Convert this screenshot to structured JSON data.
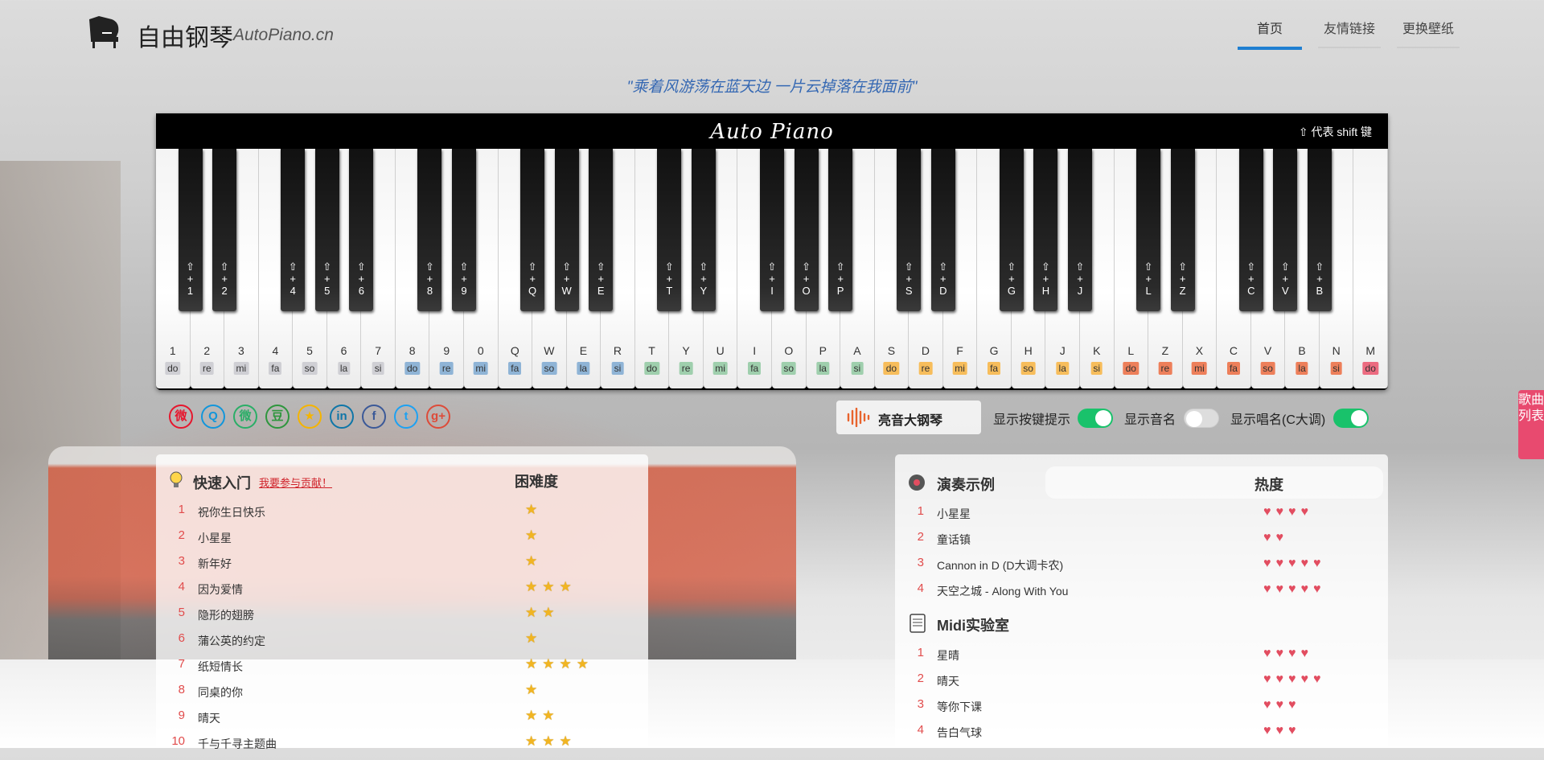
{
  "site": {
    "title": "自由钢琴",
    "subtitle": "AutoPiano.cn"
  },
  "nav": [
    {
      "label": "首页",
      "active": true
    },
    {
      "label": "友情链接",
      "active": false
    },
    {
      "label": "更换壁纸",
      "active": false
    }
  ],
  "quote": "\"乘着风游荡在蓝天边 一片云掉落在我面前\"",
  "piano": {
    "brand": "Auto Piano",
    "shift_note": "⇧ 代表 shift 键",
    "white_keys": [
      {
        "k": "1",
        "s": "do",
        "c": "#cfcfd4"
      },
      {
        "k": "2",
        "s": "re",
        "c": "#cfcfd4"
      },
      {
        "k": "3",
        "s": "mi",
        "c": "#cfcfd4"
      },
      {
        "k": "4",
        "s": "fa",
        "c": "#cfcfd4"
      },
      {
        "k": "5",
        "s": "so",
        "c": "#cfcfd4"
      },
      {
        "k": "6",
        "s": "la",
        "c": "#cfcfd4"
      },
      {
        "k": "7",
        "s": "si",
        "c": "#cfcfd4"
      },
      {
        "k": "8",
        "s": "do",
        "c": "#8fb4d6"
      },
      {
        "k": "9",
        "s": "re",
        "c": "#8fb4d6"
      },
      {
        "k": "0",
        "s": "mi",
        "c": "#8fb4d6"
      },
      {
        "k": "Q",
        "s": "fa",
        "c": "#8fb4d6"
      },
      {
        "k": "W",
        "s": "so",
        "c": "#8fb4d6"
      },
      {
        "k": "E",
        "s": "la",
        "c": "#8fb4d6"
      },
      {
        "k": "R",
        "s": "si",
        "c": "#8fb4d6"
      },
      {
        "k": "T",
        "s": "do",
        "c": "#9fcfad"
      },
      {
        "k": "Y",
        "s": "re",
        "c": "#9fcfad"
      },
      {
        "k": "U",
        "s": "mi",
        "c": "#9fcfad"
      },
      {
        "k": "I",
        "s": "fa",
        "c": "#9fcfad"
      },
      {
        "k": "O",
        "s": "so",
        "c": "#9fcfad"
      },
      {
        "k": "P",
        "s": "la",
        "c": "#9fcfad"
      },
      {
        "k": "A",
        "s": "si",
        "c": "#9fcfad"
      },
      {
        "k": "S",
        "s": "do",
        "c": "#f7bd5b"
      },
      {
        "k": "D",
        "s": "re",
        "c": "#f7bd5b"
      },
      {
        "k": "F",
        "s": "mi",
        "c": "#f7bd5b"
      },
      {
        "k": "G",
        "s": "fa",
        "c": "#f7bd5b"
      },
      {
        "k": "H",
        "s": "so",
        "c": "#f7bd5b"
      },
      {
        "k": "J",
        "s": "la",
        "c": "#f7bd5b"
      },
      {
        "k": "K",
        "s": "si",
        "c": "#f7bd5b"
      },
      {
        "k": "L",
        "s": "do",
        "c": "#ed7f5a"
      },
      {
        "k": "Z",
        "s": "re",
        "c": "#ed7f5a"
      },
      {
        "k": "X",
        "s": "mi",
        "c": "#ed7f5a"
      },
      {
        "k": "C",
        "s": "fa",
        "c": "#ed7f5a"
      },
      {
        "k": "V",
        "s": "so",
        "c": "#ed7f5a"
      },
      {
        "k": "B",
        "s": "la",
        "c": "#ed7f5a"
      },
      {
        "k": "N",
        "s": "si",
        "c": "#ed7f5a"
      },
      {
        "k": "M",
        "s": "do",
        "c": "#ec6b80"
      }
    ],
    "black_keys": [
      {
        "k": "1",
        "after": 0
      },
      {
        "k": "2",
        "after": 1
      },
      {
        "k": "4",
        "after": 3
      },
      {
        "k": "5",
        "after": 4
      },
      {
        "k": "6",
        "after": 5
      },
      {
        "k": "8",
        "after": 7
      },
      {
        "k": "9",
        "after": 8
      },
      {
        "k": "Q",
        "after": 10
      },
      {
        "k": "W",
        "after": 11
      },
      {
        "k": "E",
        "after": 12
      },
      {
        "k": "T",
        "after": 14
      },
      {
        "k": "Y",
        "after": 15
      },
      {
        "k": "I",
        "after": 17
      },
      {
        "k": "O",
        "after": 18
      },
      {
        "k": "P",
        "after": 19
      },
      {
        "k": "S",
        "after": 21
      },
      {
        "k": "D",
        "after": 22
      },
      {
        "k": "G",
        "after": 24
      },
      {
        "k": "H",
        "after": 25
      },
      {
        "k": "J",
        "after": 26
      },
      {
        "k": "L",
        "after": 28
      },
      {
        "k": "Z",
        "after": 29
      },
      {
        "k": "C",
        "after": 31
      },
      {
        "k": "V",
        "after": 32
      },
      {
        "k": "B",
        "after": 33
      }
    ]
  },
  "social": [
    {
      "icon": "weibo-icon",
      "glyph": "微",
      "color": "#e6162d"
    },
    {
      "icon": "qq-icon",
      "glyph": "Q",
      "color": "#1296db"
    },
    {
      "icon": "wechat-icon",
      "glyph": "微",
      "color": "#2aae67"
    },
    {
      "icon": "douban-icon",
      "glyph": "豆",
      "color": "#2e963d"
    },
    {
      "icon": "qzone-icon",
      "glyph": "★",
      "color": "#f5b400"
    },
    {
      "icon": "linkedin-icon",
      "glyph": "in",
      "color": "#0e76a8"
    },
    {
      "icon": "facebook-icon",
      "glyph": "f",
      "color": "#3b5998"
    },
    {
      "icon": "twitter-icon",
      "glyph": "t",
      "color": "#1da1f2"
    },
    {
      "icon": "google-plus-icon",
      "glyph": "g+",
      "color": "#dd4b39"
    }
  ],
  "controls": {
    "piano_button": "亮音大钢琴",
    "show_key_hint": "显示按键提示",
    "show_key_hint_on": true,
    "show_note_name": "显示音名",
    "show_note_name_on": false,
    "show_solfege": "显示唱名(C大调)",
    "show_solfege_on": true
  },
  "side_tab": "歌曲列表",
  "quick_start": {
    "title": "快速入门",
    "link": "我要参与贡献！",
    "difficulty_header": "困难度",
    "songs": [
      {
        "n": "1",
        "name": "祝你生日快乐",
        "stars": 1
      },
      {
        "n": "2",
        "name": "小星星",
        "stars": 1
      },
      {
        "n": "3",
        "name": "新年好",
        "stars": 1
      },
      {
        "n": "4",
        "name": "因为爱情",
        "stars": 3
      },
      {
        "n": "5",
        "name": "隐形的翅膀",
        "stars": 2
      },
      {
        "n": "6",
        "name": "蒲公英的约定",
        "stars": 1
      },
      {
        "n": "7",
        "name": "纸短情长",
        "stars": 4
      },
      {
        "n": "8",
        "name": "同桌的你",
        "stars": 1
      },
      {
        "n": "9",
        "name": "晴天",
        "stars": 2
      },
      {
        "n": "10",
        "name": "千与千寻主题曲",
        "stars": 3
      }
    ]
  },
  "demos": {
    "title": "演奏示例",
    "heat_header": "热度",
    "songs": [
      {
        "n": "1",
        "name": "小星星",
        "hearts": 4
      },
      {
        "n": "2",
        "name": "童话镇",
        "hearts": 2
      },
      {
        "n": "3",
        "name": "Cannon in D (D大调卡农)",
        "hearts": 5
      },
      {
        "n": "4",
        "name": "天空之城 - Along With You",
        "hearts": 5
      }
    ]
  },
  "midi": {
    "title": "Midi实验室",
    "songs": [
      {
        "n": "1",
        "name": "星晴",
        "hearts": 4
      },
      {
        "n": "2",
        "name": "晴天",
        "hearts": 5
      },
      {
        "n": "3",
        "name": "等你下课",
        "hearts": 3
      },
      {
        "n": "4",
        "name": "告白气球",
        "hearts": 3
      }
    ]
  }
}
